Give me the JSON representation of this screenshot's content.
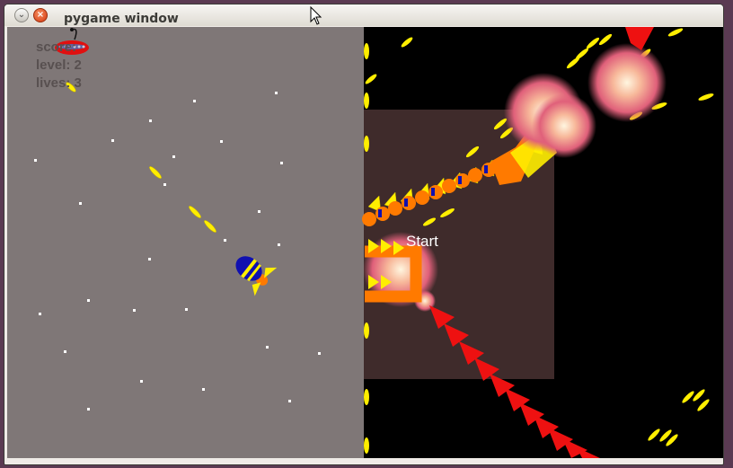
{
  "window": {
    "title": "pygame window",
    "minimize_glyph": "⌄",
    "close_glyph": "×"
  },
  "hud": {
    "score_label": "score:",
    "level_label": "level: 2",
    "lives_label": "lives: 3"
  },
  "menu": {
    "start_label": "Start"
  },
  "colors": {
    "left_background": "#7f7777",
    "right_background": "#000000",
    "start_box": "#3f2b2b",
    "bullet": "#ffee00",
    "enemy_arrow": "#ee1111",
    "snake_body": "#ff7a00",
    "ship_hull": "#1010b0"
  },
  "icons": [
    "pointer-cursor-icon",
    "minimize-icon",
    "close-icon",
    "ufo-enemy-icon",
    "player-rocket-icon",
    "explosion-icon"
  ]
}
